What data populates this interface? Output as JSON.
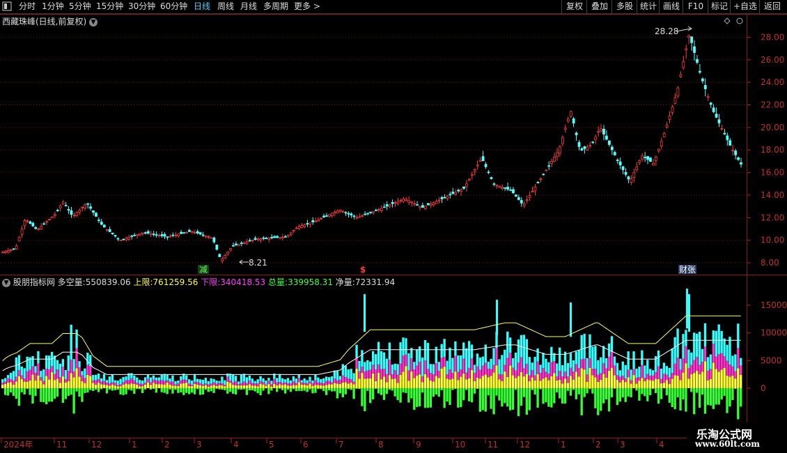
{
  "toolbar": {
    "periods": [
      "分时",
      "1分钟",
      "5分钟",
      "15分钟",
      "30分钟",
      "60分钟",
      "日线",
      "周线",
      "月线",
      "多周期",
      "更多"
    ],
    "active_period": "日线",
    "right_buttons": [
      "复权",
      "叠加",
      "多股",
      "统计",
      "画线",
      "F10",
      "标记",
      "+自选",
      "返回"
    ]
  },
  "price_panel": {
    "title": "西藏珠峰(日线,前复权)",
    "y_ticks": [
      "28.00",
      "26.00",
      "24.00",
      "22.00",
      "20.00",
      "18.00",
      "16.00",
      "14.00",
      "12.00",
      "10.00",
      "8.00"
    ],
    "high_label": "28.28",
    "low_label": "8.21",
    "markers": [
      "减",
      "$",
      "财张"
    ]
  },
  "indicator_panel": {
    "name": "股朋指标网",
    "values": [
      {
        "label": "多空量:",
        "value": "550839.06"
      },
      {
        "label": "上限:",
        "value": "761259.56"
      },
      {
        "label": "下限:",
        "value": "340418.53"
      },
      {
        "label": "总量:",
        "value": "339958.31"
      },
      {
        "label": "净量:",
        "value": "72331.94"
      }
    ],
    "y_ticks": [
      "15000",
      "10000",
      "5000",
      "0"
    ]
  },
  "time_axis": [
    "2024年",
    "11",
    "12",
    "1",
    "2",
    "3",
    "4",
    "5",
    "6",
    "7",
    "8",
    "9",
    "10",
    "11",
    "12",
    "1",
    "2",
    "3",
    "4"
  ],
  "watermark": {
    "line1": "乐淘公式网",
    "line2": "www.60lt.com"
  },
  "chart_data": {
    "type": "candlestick",
    "title": "西藏珠峰(日线,前复权)",
    "price_range": [
      7.2,
      29.2
    ],
    "price_anchors": [
      [
        "2024-10",
        8.7
      ],
      [
        "2024-11-mid",
        12.0
      ],
      [
        "2024-11-end",
        13.4
      ],
      [
        "2024-12-mid",
        13.3
      ],
      [
        "2025-01",
        10.1
      ],
      [
        "2025-02",
        10.4
      ],
      [
        "2025-03",
        10.2
      ],
      [
        "2025-04",
        8.21
      ],
      [
        "2025-05",
        9.8
      ],
      [
        "2025-06",
        10.2
      ],
      [
        "2025-07",
        11.8
      ],
      [
        "2025-08",
        12.4
      ],
      [
        "2025-09",
        13.5
      ],
      [
        "2025-10",
        13.3
      ],
      [
        "2025-11",
        17.3
      ],
      [
        "2025-11-end",
        14.8
      ],
      [
        "2025-12",
        13.0
      ],
      [
        "2026-01",
        18.0
      ],
      [
        "2026-01-end",
        22.0
      ],
      [
        "2026-02",
        17.5
      ],
      [
        "2026-02-mid",
        20.0
      ],
      [
        "2026-03",
        15.0
      ],
      [
        "2026-03-mid",
        19.0
      ],
      [
        "2026-04",
        22.0
      ],
      [
        "2026-04-mid",
        28.28
      ],
      [
        "2026-04-end",
        21.0
      ],
      [
        "2026-05",
        16.0
      ]
    ],
    "indicator_range": [
      -8000,
      19000
    ],
    "indicator_series": [
      "多空量",
      "上限",
      "下限",
      "总量",
      "净量"
    ]
  }
}
